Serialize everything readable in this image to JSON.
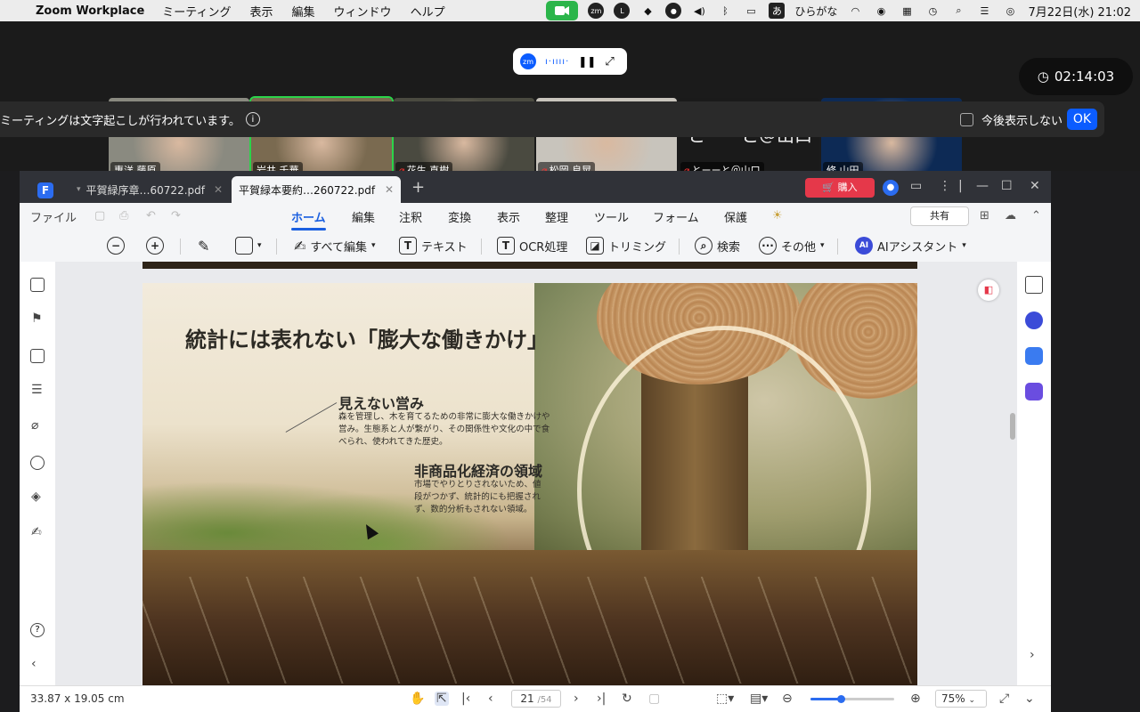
{
  "menubar": {
    "app_name": "Zoom Workplace",
    "items": [
      "ミーティング",
      "表示",
      "編集",
      "ウィンドウ",
      "ヘルプ"
    ],
    "input_mode": "あ",
    "input_label": "ひらがな",
    "datetime": "7月22日(水)  21:02"
  },
  "zoom": {
    "timer": "02:14:03",
    "transcript_notice": "ミーティングは文字起こしが行われています。",
    "dont_show_label": "今後表示しない",
    "ok_label": "OK",
    "participants": [
      {
        "name": "惠洋 藤原",
        "muted": false,
        "bg": "#8a8a80"
      },
      {
        "name": "岩井 千華",
        "muted": false,
        "bg": "#7a6a50"
      },
      {
        "name": "花生 直樹",
        "muted": true,
        "bg": "#4a4a40"
      },
      {
        "name": "松岡 良晃",
        "muted": true,
        "bg": "#c8c4bc"
      },
      {
        "name": "とーーと＠山口",
        "muted": true,
        "bg": "#1a1a1a",
        "big_text": "とーーと＠山口"
      },
      {
        "name": "修 山田",
        "muted": false,
        "bg": "#0d2a55"
      }
    ]
  },
  "pdf": {
    "tabs": [
      {
        "label": "平賀緑序章…60722.pdf",
        "active": false
      },
      {
        "label": "平賀緑本要約…260722.pdf",
        "active": true
      }
    ],
    "buy_label": "購入",
    "file_label": "ファイル",
    "ribbon_tabs": [
      "ホーム",
      "編集",
      "注釈",
      "変換",
      "表示",
      "整理",
      "ツール",
      "フォーム",
      "保護"
    ],
    "share_label": "共有",
    "toolbar": {
      "edit_all": "すべて編集",
      "text": "テキスト",
      "ocr": "OCR処理",
      "trim": "トリミング",
      "search": "検索",
      "more": "その他",
      "ai": "AIアシスタント"
    },
    "page_content": {
      "title": "統計には表れない「膨大な働きかけ」",
      "heading1": "見えない営み",
      "body1": "森を管理し、木を育てるための非常に膨大な働きかけや営み。生態系と人が繋がり、その関係性や文化の中で食べられ、使われてきた歴史。",
      "heading2": "非商品化経済の領域",
      "body2": "市場でやりとりされないため、値段がつかず、統計的にも把握されず、数的分析もされない領域。"
    },
    "status": {
      "dimensions": "33.87 x 19.05 cm",
      "current_page": "21",
      "total_pages": "/54",
      "zoom": "75%",
      "zoom_fraction": 0.36
    }
  }
}
